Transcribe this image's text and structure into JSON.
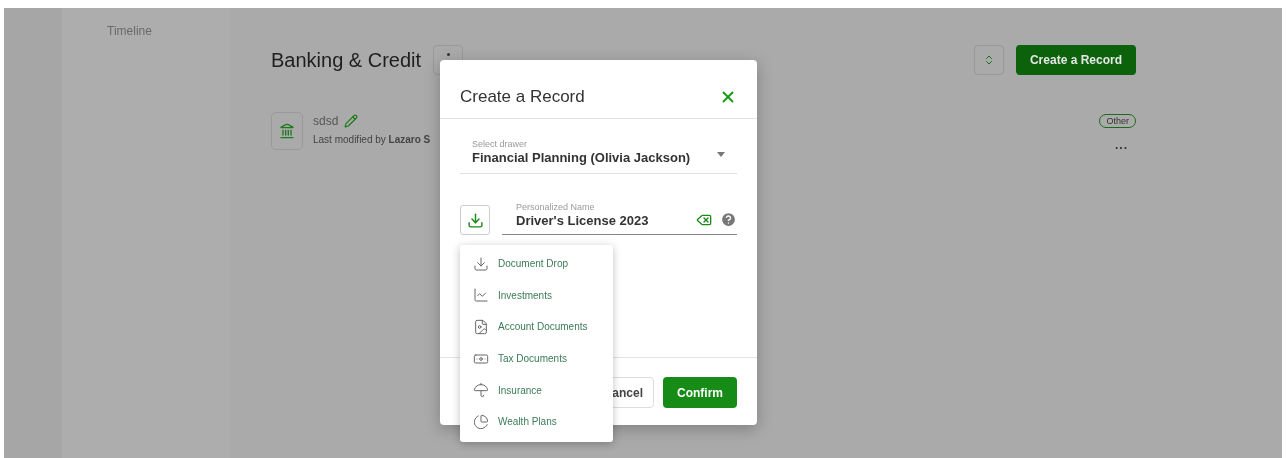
{
  "sidebar": {
    "items": [
      {
        "label": "Timeline"
      }
    ]
  },
  "header": {
    "title": "Banking & Credit",
    "create_button": "Create a Record"
  },
  "records": [
    {
      "name": "sdsd",
      "modified": "Last modified by **Lazaro S**",
      "tag": "Other",
      "more": "..."
    }
  ],
  "dialog": {
    "title": "Create a Record",
    "drawer": {
      "label": "Select drawer",
      "value": "Financial Planning (Olivia Jackson)"
    },
    "name_field": {
      "label": "Personalized Name",
      "value": "Driver's License 2023"
    },
    "menu": [
      {
        "label": "Document Drop",
        "kind": "drop"
      },
      {
        "label": "Investments",
        "kind": "investments"
      },
      {
        "label": "Account Documents",
        "kind": "account"
      },
      {
        "label": "Tax Documents",
        "kind": "tax"
      },
      {
        "label": "Insurance",
        "kind": "insurance"
      },
      {
        "label": "Wealth Plans",
        "kind": "wealth"
      }
    ],
    "buttons": {
      "cancel": "ancel",
      "confirm": "Confirm"
    }
  }
}
